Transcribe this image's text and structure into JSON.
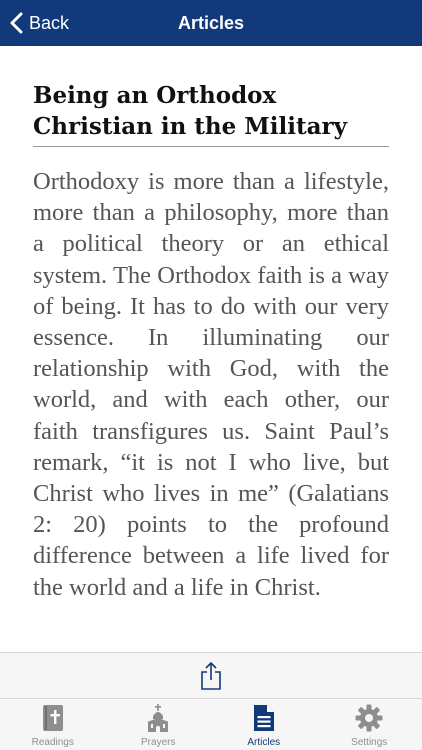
{
  "navbar": {
    "back_label": "Back",
    "title": "Articles"
  },
  "article": {
    "title": "Being an Orthodox Christian in the Military",
    "body": "Orthodoxy is more than a lifestyle, more than a philosophy, more than a political theory or an ethical system. The Orthodox faith is a way of being. It has to do with our very essence. In illuminating our relationship with God, with the world, and with each other, our faith transfigures us. Saint Paul’s remark, “it is not I who live, but Christ who lives in me” (Galatians 2: 20) points to the profound difference between a life lived for the world and a life in Christ."
  },
  "toolbar": {
    "share_icon": "share-icon"
  },
  "tabs": [
    {
      "label": "Readings",
      "icon": "bible-icon",
      "active": false
    },
    {
      "label": "Prayers",
      "icon": "church-icon",
      "active": false
    },
    {
      "label": "Articles",
      "icon": "document-icon",
      "active": true
    },
    {
      "label": "Settings",
      "icon": "gear-icon",
      "active": false
    }
  ],
  "colors": {
    "navbar": "#123a7a",
    "active_tab": "#123a7a",
    "inactive_tab": "#8e8e8e",
    "body_text": "#555555"
  }
}
